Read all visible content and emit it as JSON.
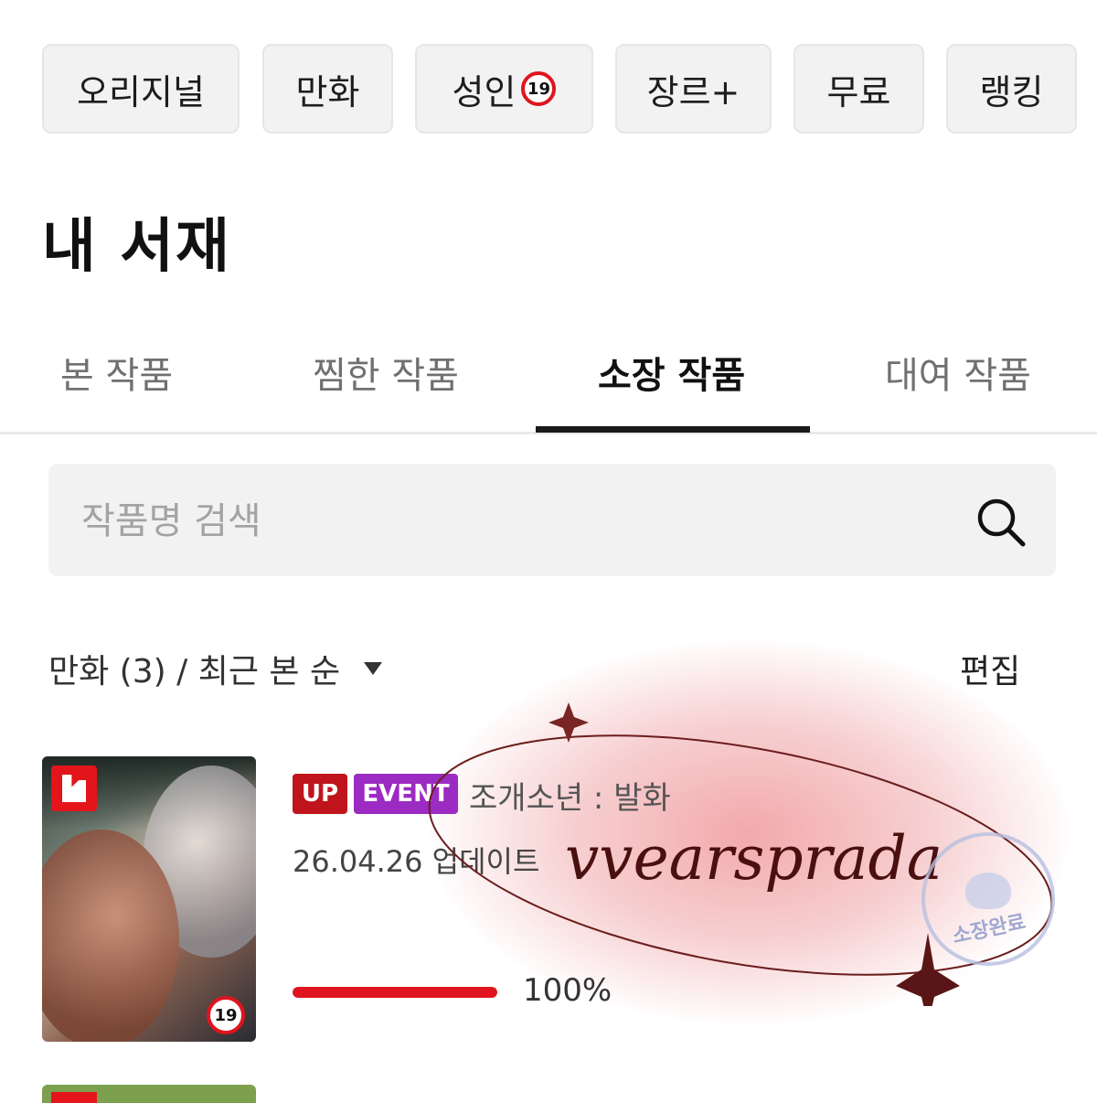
{
  "categories": [
    {
      "label": "오리지널"
    },
    {
      "label": "만화"
    },
    {
      "label": "성인",
      "badge": "19"
    },
    {
      "label": "장르+"
    },
    {
      "label": "무료"
    },
    {
      "label": "랭킹"
    }
  ],
  "page_title": "내 서재",
  "tabs": [
    {
      "label": "본 작품",
      "active": false
    },
    {
      "label": "찜한 작품",
      "active": false
    },
    {
      "label": "소장 작품",
      "active": true
    },
    {
      "label": "대여 작품",
      "active": false
    }
  ],
  "search": {
    "placeholder": "작품명 검색",
    "value": ""
  },
  "sort": {
    "label": "만화 (3) / 최근 본 순"
  },
  "edit_label": "편집",
  "items": [
    {
      "tags": [
        "UP",
        "EVENT"
      ],
      "title": "조개소년 : 발화",
      "update": "26.04.26 업데이트",
      "progress": 1.0,
      "progress_label": "100%",
      "age_badge": "19"
    }
  ],
  "overlay": {
    "watermark": "vvearsprada",
    "stamp_text": "소장완료"
  },
  "colors": {
    "accent": "#e0141e",
    "up_tag": "#c0141c",
    "event_tag": "#9b2bc2"
  }
}
